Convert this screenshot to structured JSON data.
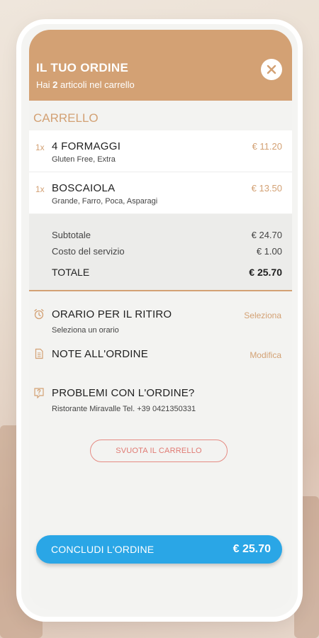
{
  "header": {
    "title": "IL TUO ORDINE",
    "subtitle_prefix": "Hai",
    "item_count": "2",
    "subtitle_suffix": "articoli nel carrello",
    "close_icon": "close-icon"
  },
  "cart": {
    "title": "CARRELLO",
    "items": [
      {
        "qty": "1x",
        "name": "4 FORMAGGI",
        "options": "Gluten Free, Extra",
        "price": "€ 11.20"
      },
      {
        "qty": "1x",
        "name": "BOSCAIOLA",
        "options": "Grande, Farro, Poca, Asparagi",
        "price": "€ 13.50"
      }
    ]
  },
  "totals": {
    "subtotal_label": "Subtotale",
    "subtotal_value": "€ 24.70",
    "service_label": "Costo del servizio",
    "service_value": "€ 1.00",
    "total_label": "TOTALE",
    "total_value": "€ 25.70"
  },
  "pickup": {
    "icon": "alarm-clock-icon",
    "title": "ORARIO PER IL RITIRO",
    "subtitle": "Seleziona un orario",
    "action": "Seleziona"
  },
  "notes": {
    "icon": "document-icon",
    "title": "NOTE ALL'ORDINE",
    "action": "Modifica"
  },
  "problems": {
    "icon": "help-icon",
    "title": "PROBLEMI CON L'ORDINE?",
    "subtitle": "Ristorante Miravalle Tel. +39 0421350331"
  },
  "empty_cart_label": "SVUOTA IL CARRELLO",
  "checkout": {
    "label": "CONCLUDI L'ORDINE",
    "amount": "€ 25.70"
  },
  "colors": {
    "accent": "#d3a174",
    "primary_button": "#2aa6e6",
    "danger": "#e07a73"
  }
}
